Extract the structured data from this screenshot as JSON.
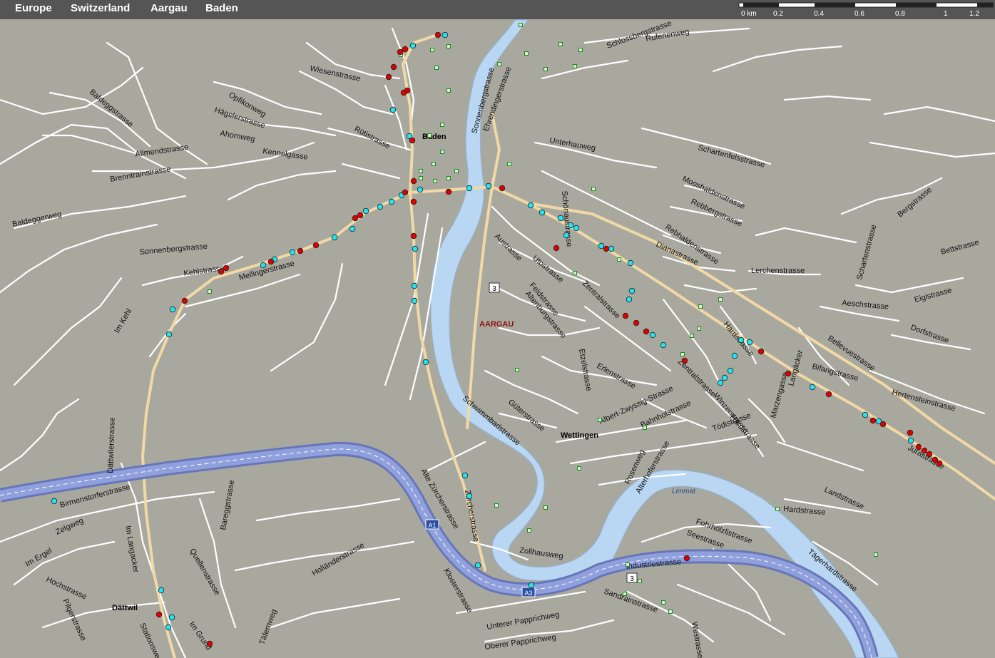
{
  "breadcrumb": [
    {
      "label": "Europe"
    },
    {
      "label": "Switzerland"
    },
    {
      "label": "Aargau"
    },
    {
      "label": "Baden"
    }
  ],
  "scale": {
    "unit": "0 km",
    "ticks": [
      "0.2",
      "0.4",
      "0.6",
      "0.8",
      "1",
      "1.2"
    ]
  },
  "colors": {
    "land": "#a9a89f",
    "street": "#ffffff",
    "main_road": "#f1d9a6",
    "motorway": "#7f8fcf",
    "water": "#b9d6f2",
    "marker_red": "#e00000",
    "marker_cyan": "#22e4f0"
  },
  "map": {
    "places": {
      "baden": "Baden",
      "wettingen": "Wettingen",
      "dattwil": "Dättwil",
      "aargau": "AARGAU"
    },
    "river": "Limmat",
    "shields": {
      "route3a": "3",
      "route3b": "3",
      "a1": "A1",
      "a3": "A3"
    },
    "streets": [
      {
        "name": "Wiesenstrasse"
      },
      {
        "name": "Rütistrasse"
      },
      {
        "name": "Hägelerstrasse"
      },
      {
        "name": "Ahornweg"
      },
      {
        "name": "Kennelgasse"
      },
      {
        "name": "Brenntrainstrasse"
      },
      {
        "name": "Allmendstrasse"
      },
      {
        "name": "Baldeggstrasse"
      },
      {
        "name": "Baldeggerweg"
      },
      {
        "name": "Sonnenbergstrasse"
      },
      {
        "name": "Kehlstrasse"
      },
      {
        "name": "Mellingerstrasse"
      },
      {
        "name": "Im Kehl"
      },
      {
        "name": "Dättwilerstrasse"
      },
      {
        "name": "Birmenstorferstrasse"
      },
      {
        "name": "Zelgweg"
      },
      {
        "name": "Im Ergel"
      },
      {
        "name": "Hochstrasse"
      },
      {
        "name": "Pilgerstrasse"
      },
      {
        "name": "Im Langacker"
      },
      {
        "name": "Stationsweg"
      },
      {
        "name": "Im Grund"
      },
      {
        "name": "Quellenstrasse"
      },
      {
        "name": "Täfernweg"
      },
      {
        "name": "Holländerstrasse"
      },
      {
        "name": "Bareggstrasse"
      },
      {
        "name": "Alte Zürcherstrasse"
      },
      {
        "name": "Zürcherstrasse"
      },
      {
        "name": "Klosterstrasse"
      },
      {
        "name": "Unterer Papprichweg"
      },
      {
        "name": "Oberer Papprichweg"
      },
      {
        "name": "Zollhausweg"
      },
      {
        "name": "Schwimmbadstrasse"
      },
      {
        "name": "Güterstrasse"
      },
      {
        "name": "Austrasse"
      },
      {
        "name": "Feldstrasse"
      },
      {
        "name": "Altenburgstrasse"
      },
      {
        "name": "Sonnenbergstrasse"
      },
      {
        "name": "Ehrendingerstrasse"
      },
      {
        "name": "Schlossbergstrasse"
      },
      {
        "name": "Rufenenweg"
      },
      {
        "name": "Unterhauweg"
      },
      {
        "name": "Schartenfelsstrasse"
      },
      {
        "name": "Mooshaldenstrasse"
      },
      {
        "name": "Rebbergstrasse"
      },
      {
        "name": "Rebhaldenstrasse"
      },
      {
        "name": "Dianastrasse"
      },
      {
        "name": "Lerchenstrasse"
      },
      {
        "name": "Schartenstrasse"
      },
      {
        "name": "Bergstrasse"
      },
      {
        "name": "Bettstrasse"
      },
      {
        "name": "Eigistrasse"
      },
      {
        "name": "Aeschstrasse"
      },
      {
        "name": "Dorfstrasse"
      },
      {
        "name": "Hertensteinstrasse"
      },
      {
        "name": "Bellevuestrasse"
      },
      {
        "name": "Bifangstrasse"
      },
      {
        "name": "Langäcker"
      },
      {
        "name": "Marzengasse"
      },
      {
        "name": "Jurastrasse"
      },
      {
        "name": "Landstrasse"
      },
      {
        "name": "Hardstrasse"
      },
      {
        "name": "Tägerhardstrasse"
      },
      {
        "name": "Fohrhölzlistrasse"
      },
      {
        "name": "Seestrasse"
      },
      {
        "name": "Industriestrasse"
      },
      {
        "name": "Sandrainstrasse"
      },
      {
        "name": "Westrasse"
      },
      {
        "name": "Hardstrasse"
      },
      {
        "name": "Tödistrasse"
      },
      {
        "name": "Winzerstrasse"
      },
      {
        "name": "Zentralstrasse"
      },
      {
        "name": "Albert-Zwyssig-Strasse"
      },
      {
        "name": "Bahnhofstrasse"
      },
      {
        "name": "Erlenstrasse"
      },
      {
        "name": "Etzelstrasse"
      },
      {
        "name": "Rosenweg"
      },
      {
        "name": "Alterhoferstrasse"
      },
      {
        "name": "Zentralstrasse"
      },
      {
        "name": "Utostrasse"
      },
      {
        "name": "Schönaustrasse"
      },
      {
        "name": "Hardstrasse"
      },
      {
        "name": "Opfikonweg"
      }
    ]
  }
}
